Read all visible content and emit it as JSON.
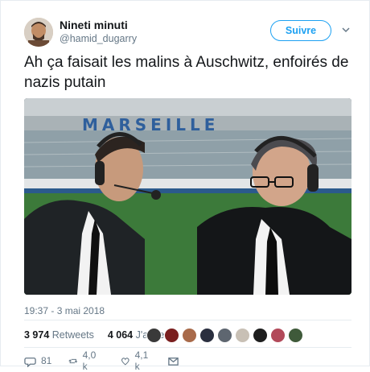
{
  "user": {
    "name": "Nineti minuti",
    "handle": "@hamid_dugarry"
  },
  "follow_label": "Suivre",
  "tweet_text": "Ah ça faisait les malins à Auschwitz, enfoirés de nazis putain",
  "media": {
    "stadium_sign": "MARSEILLE"
  },
  "timestamp": "19:37 - 3 mai 2018",
  "stats": {
    "retweets_count": "3 974",
    "retweets_label": "Retweets",
    "likes_count": "4 064",
    "likes_label": "J'aime"
  },
  "actions": {
    "replies": "81",
    "retweets": "4,0 k",
    "likes": "4,1 k"
  },
  "colors": {
    "accent": "#1da1f2",
    "secondary_text": "#657786"
  }
}
